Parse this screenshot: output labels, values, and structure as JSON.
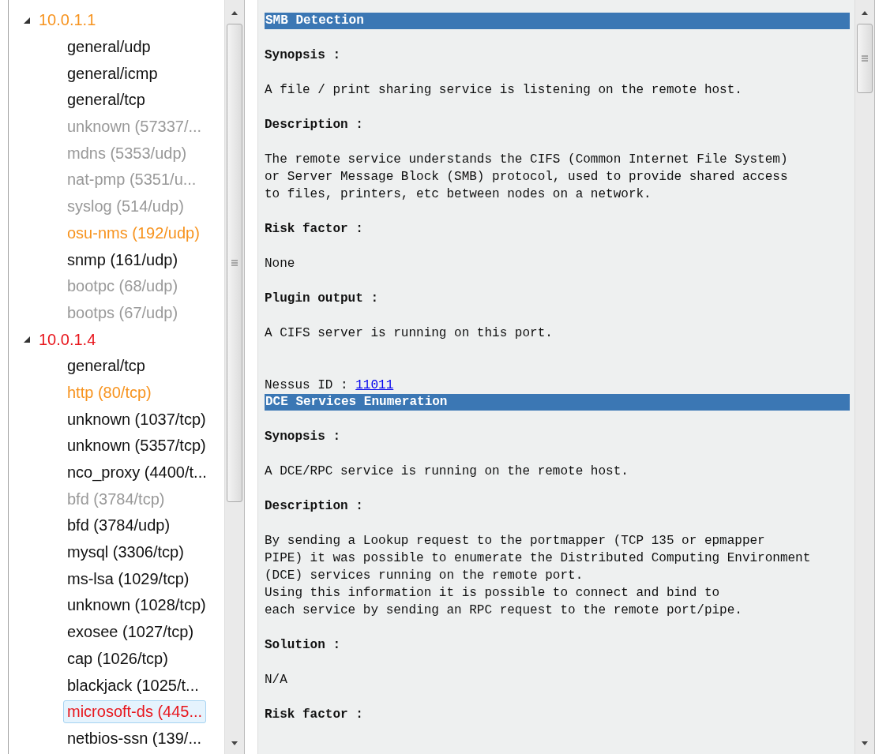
{
  "tree": [
    {
      "label": "10.0.1.1",
      "color": "#f7931e",
      "expanded": true,
      "children": [
        {
          "label": "general/udp",
          "color": "#111111",
          "selected": false
        },
        {
          "label": "general/icmp",
          "color": "#111111",
          "selected": false
        },
        {
          "label": "general/tcp",
          "color": "#111111",
          "selected": false
        },
        {
          "label": "unknown (57337/...",
          "color": "#999999",
          "selected": false
        },
        {
          "label": "mdns (5353/udp)",
          "color": "#999999",
          "selected": false
        },
        {
          "label": "nat-pmp (5351/u...",
          "color": "#999999",
          "selected": false
        },
        {
          "label": "syslog (514/udp)",
          "color": "#999999",
          "selected": false
        },
        {
          "label": "osu-nms (192/udp)",
          "color": "#f7931e",
          "selected": false
        },
        {
          "label": "snmp (161/udp)",
          "color": "#111111",
          "selected": false
        },
        {
          "label": "bootpc (68/udp)",
          "color": "#999999",
          "selected": false
        },
        {
          "label": "bootps (67/udp)",
          "color": "#999999",
          "selected": false
        }
      ]
    },
    {
      "label": "10.0.1.4",
      "color": "#e8161c",
      "expanded": true,
      "children": [
        {
          "label": "general/tcp",
          "color": "#111111",
          "selected": false
        },
        {
          "label": "http (80/tcp)",
          "color": "#f7931e",
          "selected": false
        },
        {
          "label": "unknown (1037/tcp)",
          "color": "#111111",
          "selected": false
        },
        {
          "label": "unknown (5357/tcp)",
          "color": "#111111",
          "selected": false
        },
        {
          "label": "nco_proxy (4400/t...",
          "color": "#111111",
          "selected": false
        },
        {
          "label": "bfd (3784/tcp)",
          "color": "#999999",
          "selected": false
        },
        {
          "label": "bfd (3784/udp)",
          "color": "#111111",
          "selected": false
        },
        {
          "label": "mysql (3306/tcp)",
          "color": "#111111",
          "selected": false
        },
        {
          "label": "ms-lsa (1029/tcp)",
          "color": "#111111",
          "selected": false
        },
        {
          "label": "unknown (1028/tcp)",
          "color": "#111111",
          "selected": false
        },
        {
          "label": "exosee (1027/tcp)",
          "color": "#111111",
          "selected": false
        },
        {
          "label": "cap (1026/tcp)",
          "color": "#111111",
          "selected": false
        },
        {
          "label": "blackjack (1025/t...",
          "color": "#111111",
          "selected": false
        },
        {
          "label": "microsoft-ds (445...",
          "color": "#e8161c",
          "selected": true
        },
        {
          "label": "netbios-ssn (139/...",
          "color": "#111111",
          "selected": false
        }
      ]
    }
  ],
  "sections": [
    {
      "title": "SMB Detection",
      "blocks": [
        {
          "kind": "label",
          "text": "Synopsis :"
        },
        {
          "kind": "text",
          "text": "A file / print sharing service is listening on the remote host."
        },
        {
          "kind": "label",
          "text": "Description :"
        },
        {
          "kind": "text",
          "text": "The remote service understands the CIFS (Common Internet File System)\nor Server Message Block (SMB) protocol, used to provide shared access\nto files, printers, etc between nodes on a network."
        },
        {
          "kind": "label",
          "text": "Risk factor :"
        },
        {
          "kind": "text",
          "text": "None"
        },
        {
          "kind": "label",
          "text": "Plugin output :"
        },
        {
          "kind": "text",
          "text": "A CIFS server is running on this port."
        },
        {
          "kind": "id",
          "text": "Nessus ID : ",
          "link": "11011"
        }
      ]
    },
    {
      "title": "DCE Services Enumeration",
      "blocks": [
        {
          "kind": "label",
          "text": "Synopsis :"
        },
        {
          "kind": "text",
          "text": "A DCE/RPC service is running on the remote host."
        },
        {
          "kind": "label",
          "text": "Description :"
        },
        {
          "kind": "text",
          "text": "By sending a Lookup request to the portmapper (TCP 135 or epmapper\nPIPE) it was possible to enumerate the Distributed Computing Environment\n(DCE) services running on the remote port.\nUsing this information it is possible to connect and bind to\neach service by sending an RPC request to the remote port/pipe."
        },
        {
          "kind": "label",
          "text": "Solution :"
        },
        {
          "kind": "text",
          "text": "N/A"
        },
        {
          "kind": "label",
          "text": "Risk factor :"
        }
      ]
    }
  ]
}
